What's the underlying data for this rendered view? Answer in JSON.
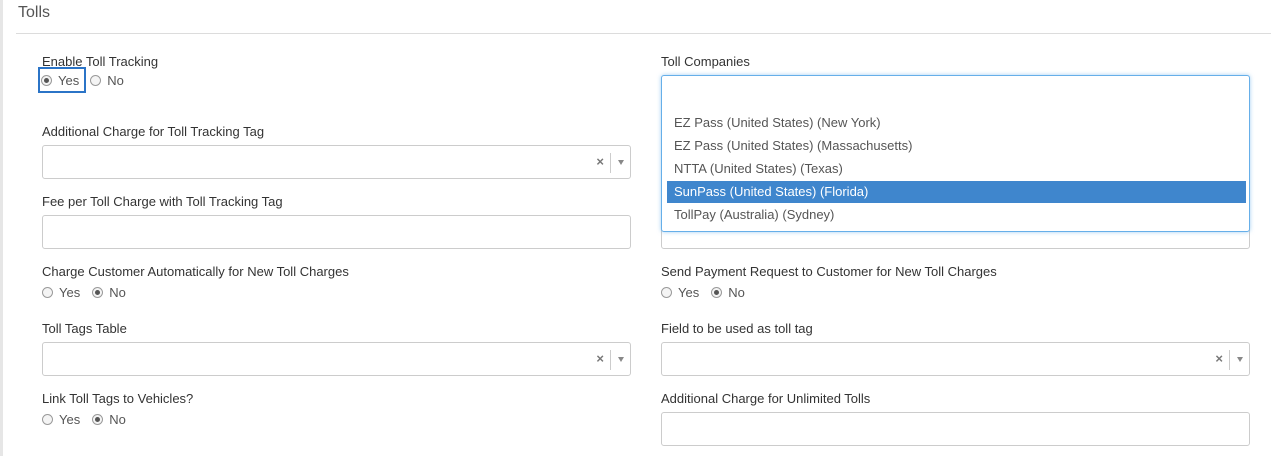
{
  "section": {
    "title": "Tolls"
  },
  "left": {
    "enable_toll_tracking": {
      "label": "Enable Toll Tracking",
      "yes": "Yes",
      "no": "No",
      "selected": "Yes"
    },
    "additional_charge_tag": {
      "label": "Additional Charge for Toll Tracking Tag",
      "value": "",
      "clear": "×"
    },
    "fee_per_toll_charge": {
      "label": "Fee per Toll Charge with Toll Tracking Tag",
      "value": ""
    },
    "charge_customer_auto": {
      "label": "Charge Customer Automatically for New Toll Charges",
      "yes": "Yes",
      "no": "No",
      "selected": "No"
    },
    "toll_tags_table": {
      "label": "Toll Tags Table",
      "value": "",
      "clear": "×"
    },
    "link_toll_tags": {
      "label": "Link Toll Tags to Vehicles?",
      "yes": "Yes",
      "no": "No",
      "selected": "No"
    }
  },
  "right": {
    "toll_companies": {
      "label": "Toll Companies",
      "options": [
        "EZ Pass (United States) (New York)",
        "EZ Pass (United States) (Massachusetts)",
        "NTTA (United States) (Texas)",
        "SunPass (United States) (Florida)",
        "TollPay (Australia) (Sydney)"
      ],
      "highlighted": "SunPass (United States) (Florida)"
    },
    "send_payment_request": {
      "label": "Send Payment Request to Customer for New Toll Charges",
      "yes": "Yes",
      "no": "No",
      "selected": "No"
    },
    "toll_tag_field": {
      "label": "Field to be used as toll tag",
      "value": "",
      "clear": "×"
    },
    "unlimited_tolls_charge": {
      "label": "Additional Charge for Unlimited Tolls",
      "value": ""
    }
  },
  "colors": {
    "accent": "#3f86cd",
    "focus": "#2b74c7",
    "border": "#cccccc"
  }
}
